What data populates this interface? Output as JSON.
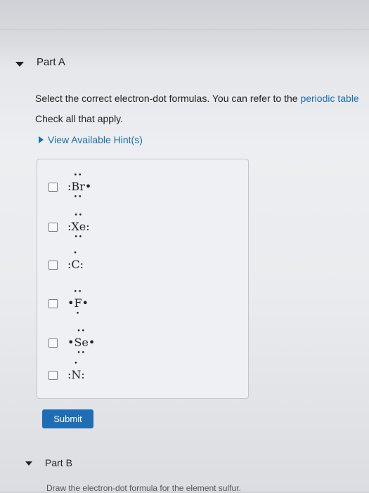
{
  "partA": {
    "title": "Part A",
    "instruction": "Select the correct electron-dot formulas. You can refer to the ",
    "instruction_link": "periodic table",
    "check_all": "Check all that apply.",
    "hint_label": "View Available Hint(s)",
    "options": [
      {
        "left": ":",
        "symbol": "Br",
        "right": "•",
        "top": "••",
        "bottom": "••",
        "checked": false
      },
      {
        "left": ":",
        "symbol": "Xe",
        "right": ":",
        "top": "••",
        "bottom": "••",
        "checked": false
      },
      {
        "left": ":",
        "symbol": "C",
        "right": ":",
        "top": "•",
        "bottom": "",
        "checked": false
      },
      {
        "left": "•",
        "symbol": "F",
        "right": "•",
        "top": "••",
        "bottom": "•",
        "checked": false
      },
      {
        "left": "•",
        "symbol": "Se",
        "right": "•",
        "top": "••",
        "bottom": "••",
        "checked": false
      },
      {
        "left": ":",
        "symbol": "N",
        "right": ":",
        "top": "•",
        "bottom": "",
        "checked": false
      }
    ],
    "submit_label": "Submit"
  },
  "partB": {
    "title": "Part B",
    "description": "Draw the electron-dot formula for the element sulfur."
  },
  "colors": {
    "link": "#1a6fb3",
    "submit_bg": "#1f6db5"
  }
}
